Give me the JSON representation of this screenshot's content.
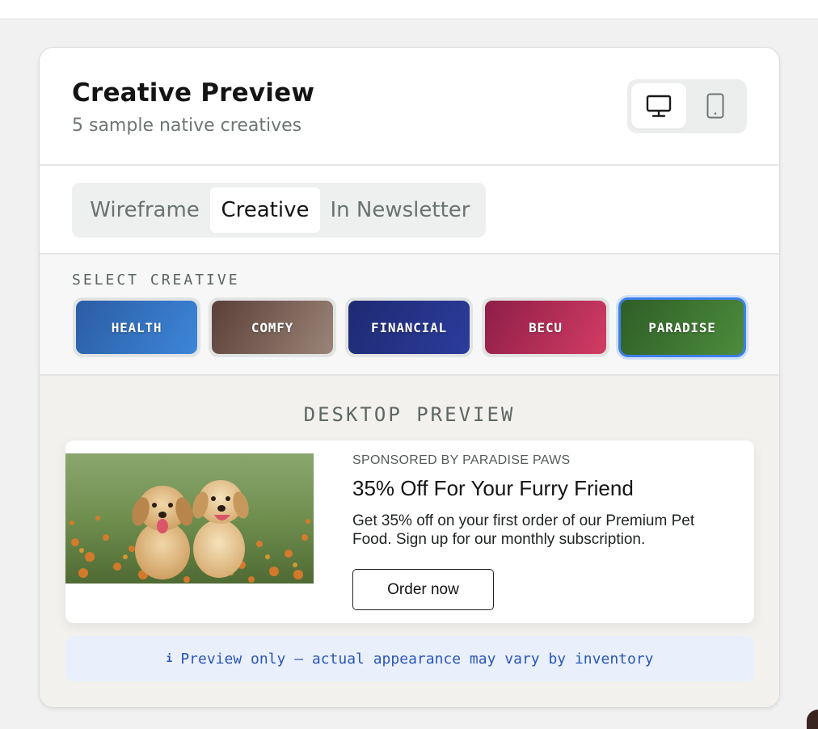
{
  "header": {
    "title": "Creative Preview",
    "subtitle": "5 sample native creatives",
    "device_toggle": [
      {
        "name": "desktop",
        "icon": "desktop-icon",
        "selected": true
      },
      {
        "name": "mobile",
        "icon": "mobile-icon",
        "selected": false
      }
    ]
  },
  "view_tabs": [
    {
      "label": "Wireframe",
      "selected": false
    },
    {
      "label": "Creative",
      "selected": true
    },
    {
      "label": "In Newsletter",
      "selected": false
    }
  ],
  "creative_selector": {
    "label": "SELECT CREATIVE",
    "options": [
      {
        "label": "HEALTH",
        "colors": [
          "#2b5da4",
          "#3d86d9"
        ],
        "selected": false
      },
      {
        "label": "COMFY",
        "colors": [
          "#5a4038",
          "#9b8478"
        ],
        "selected": false
      },
      {
        "label": "FINANCIAL",
        "colors": [
          "#1e2a72",
          "#2c3c9c"
        ],
        "selected": false
      },
      {
        "label": "BECU",
        "colors": [
          "#8e1e48",
          "#d23c64"
        ],
        "selected": false
      },
      {
        "label": "PARADISE",
        "colors": [
          "#2f5e27",
          "#4c8c3c"
        ],
        "selected": true
      }
    ]
  },
  "preview": {
    "label": "DESKTOP PREVIEW",
    "ad": {
      "image": "puppies-photo",
      "sponsor": "SPONSORED BY PARADISE PAWS",
      "headline": "35% Off For Your Furry Friend",
      "body": "Get 35% off on your first order of our Premium Pet Food. Sign up for our monthly subscription.",
      "cta": "Order now"
    },
    "note": {
      "icon": "info-icon",
      "text": "Preview only — actual appearance may vary by inventory"
    }
  },
  "colors": {
    "accent": "#3f7fe8",
    "note_text": "#2b56b8",
    "note_bg": "#e9f0fc"
  }
}
